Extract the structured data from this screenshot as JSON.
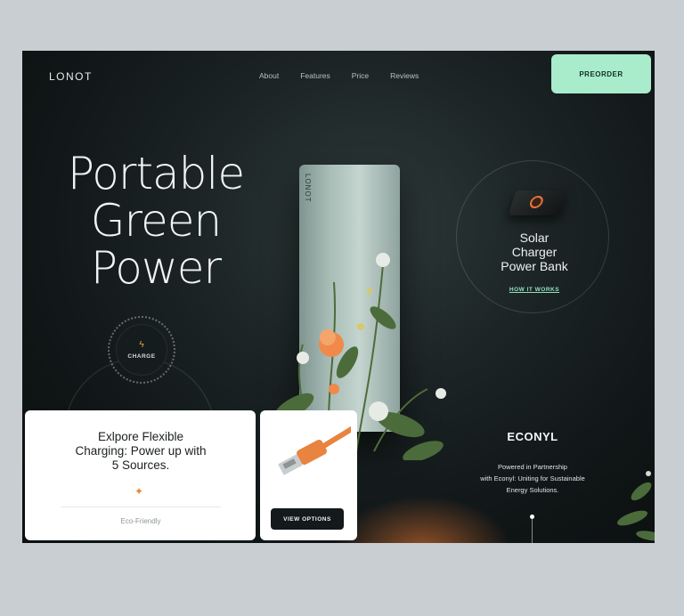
{
  "brand": {
    "logo": "LONOT"
  },
  "nav": {
    "items": [
      "About",
      "Features",
      "Price",
      "Reviews"
    ]
  },
  "header": {
    "preorder_label": "PREORDER"
  },
  "hero": {
    "title_line1": "Portable",
    "title_line2": "Green",
    "title_line3": "Power"
  },
  "charge": {
    "label": "CHARGE",
    "icon": "lightning-bolt-icon"
  },
  "product": {
    "device_logo": "LONOT"
  },
  "solar": {
    "title_line1": "Solar",
    "title_line2": "Charger",
    "title_line3": "Power Bank",
    "link_label": "HOW IT WORKS"
  },
  "partner": {
    "logo": "ECONYL",
    "line1": "Powered in Partnership",
    "line2": "with Econyl: Uniting for Sustainable",
    "line3": "Energy Solutions."
  },
  "explore_card": {
    "title_line1": "Exlpore Flexible",
    "title_line2": "Charging: Power up with",
    "title_line3": "5 Sources.",
    "tag": "Eco-Friendly"
  },
  "options_card": {
    "button_label": "VIEW OPTIONS"
  },
  "colors": {
    "accent_mint": "#a9eccc",
    "accent_orange": "#e98a3a",
    "background_dark": "#0f1415"
  }
}
